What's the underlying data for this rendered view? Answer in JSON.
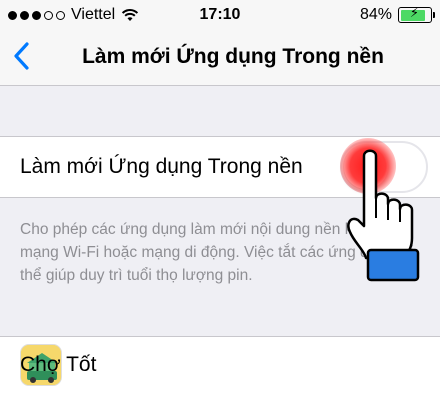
{
  "status_bar": {
    "signal_dots_filled": 2,
    "signal_dots_total": 5,
    "carrier": "Viettel",
    "time": "17:10",
    "battery_percent": "84%",
    "battery_level": 0.84,
    "charging": true
  },
  "nav": {
    "back_icon": "chevron-left-icon",
    "title": "Làm mới Ứng dụng Trong nền"
  },
  "setting": {
    "label": "Làm mới Ứng dụng Trong nền",
    "enabled": false
  },
  "footer_text": "Cho phép các ứng dụng làm mới nội dung nền khi trên mạng Wi-Fi hoặc mạng di động. Việc tắt các ứng dụng có thể giúp duy trì tuổi thọ lượng pin.",
  "apps": [
    {
      "name": "Chợ Tốt",
      "icon": "cho-tot-app-icon"
    }
  ],
  "colors": {
    "accent": "#007aff",
    "background": "#efeff4",
    "footer_text": "#8e8e93",
    "tap_indicator": "#ff3b3b",
    "battery_fill": "#4cd964",
    "cursor_cuff": "#2a7de1"
  }
}
